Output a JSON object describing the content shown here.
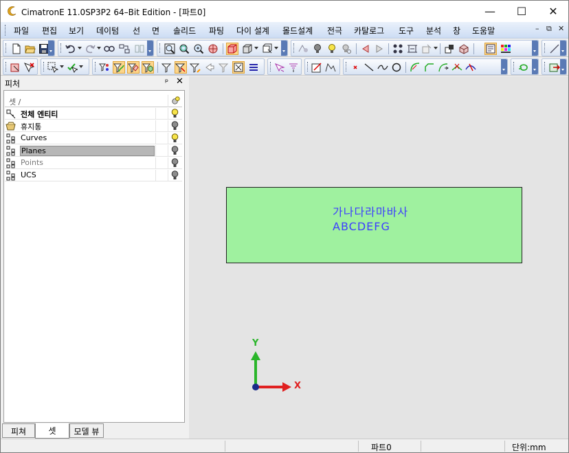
{
  "window": {
    "title": "CimatronE 11.0SP3P2 64–Bit Edition - [파트0]",
    "minimize": "—",
    "maximize": "☐",
    "close": "✕"
  },
  "menu": {
    "items": [
      "파일",
      "편집",
      "보기",
      "데이텀",
      "선",
      "면",
      "솔리드",
      "파팅",
      "다이 설계",
      "몰드설계",
      "전극",
      "카탈로그",
      "도구",
      "분석",
      "창",
      "도움말"
    ],
    "mdi_minimize": "–",
    "mdi_restore": "⧉",
    "mdi_close": "✕"
  },
  "panel": {
    "title": "피처",
    "pin": " Ԅ",
    "close": "✕",
    "column_header": "셋 /",
    "rows": [
      {
        "label": "전체 엔티티",
        "bulb": "on",
        "style": "bold"
      },
      {
        "label": "휴지통",
        "bulb": "off",
        "style": "normal"
      },
      {
        "label": "Curves",
        "bulb": "on",
        "style": "normal"
      },
      {
        "label": "Planes",
        "bulb": "off",
        "style": "selected"
      },
      {
        "label": "Points",
        "bulb": "off",
        "style": "dim"
      },
      {
        "label": "UCS",
        "bulb": "off",
        "style": "normal"
      }
    ]
  },
  "tabs": [
    "피쳐",
    "셋",
    "모델 뷰"
  ],
  "canvas": {
    "line1": "가나다라마바사",
    "line2": "ABCDEFG",
    "axis_y": "Y",
    "axis_x": "X",
    "box_color": "#9ff19f",
    "text_color": "#3d3dff"
  },
  "status": {
    "part": "파트0",
    "unit": "단위:mm"
  }
}
